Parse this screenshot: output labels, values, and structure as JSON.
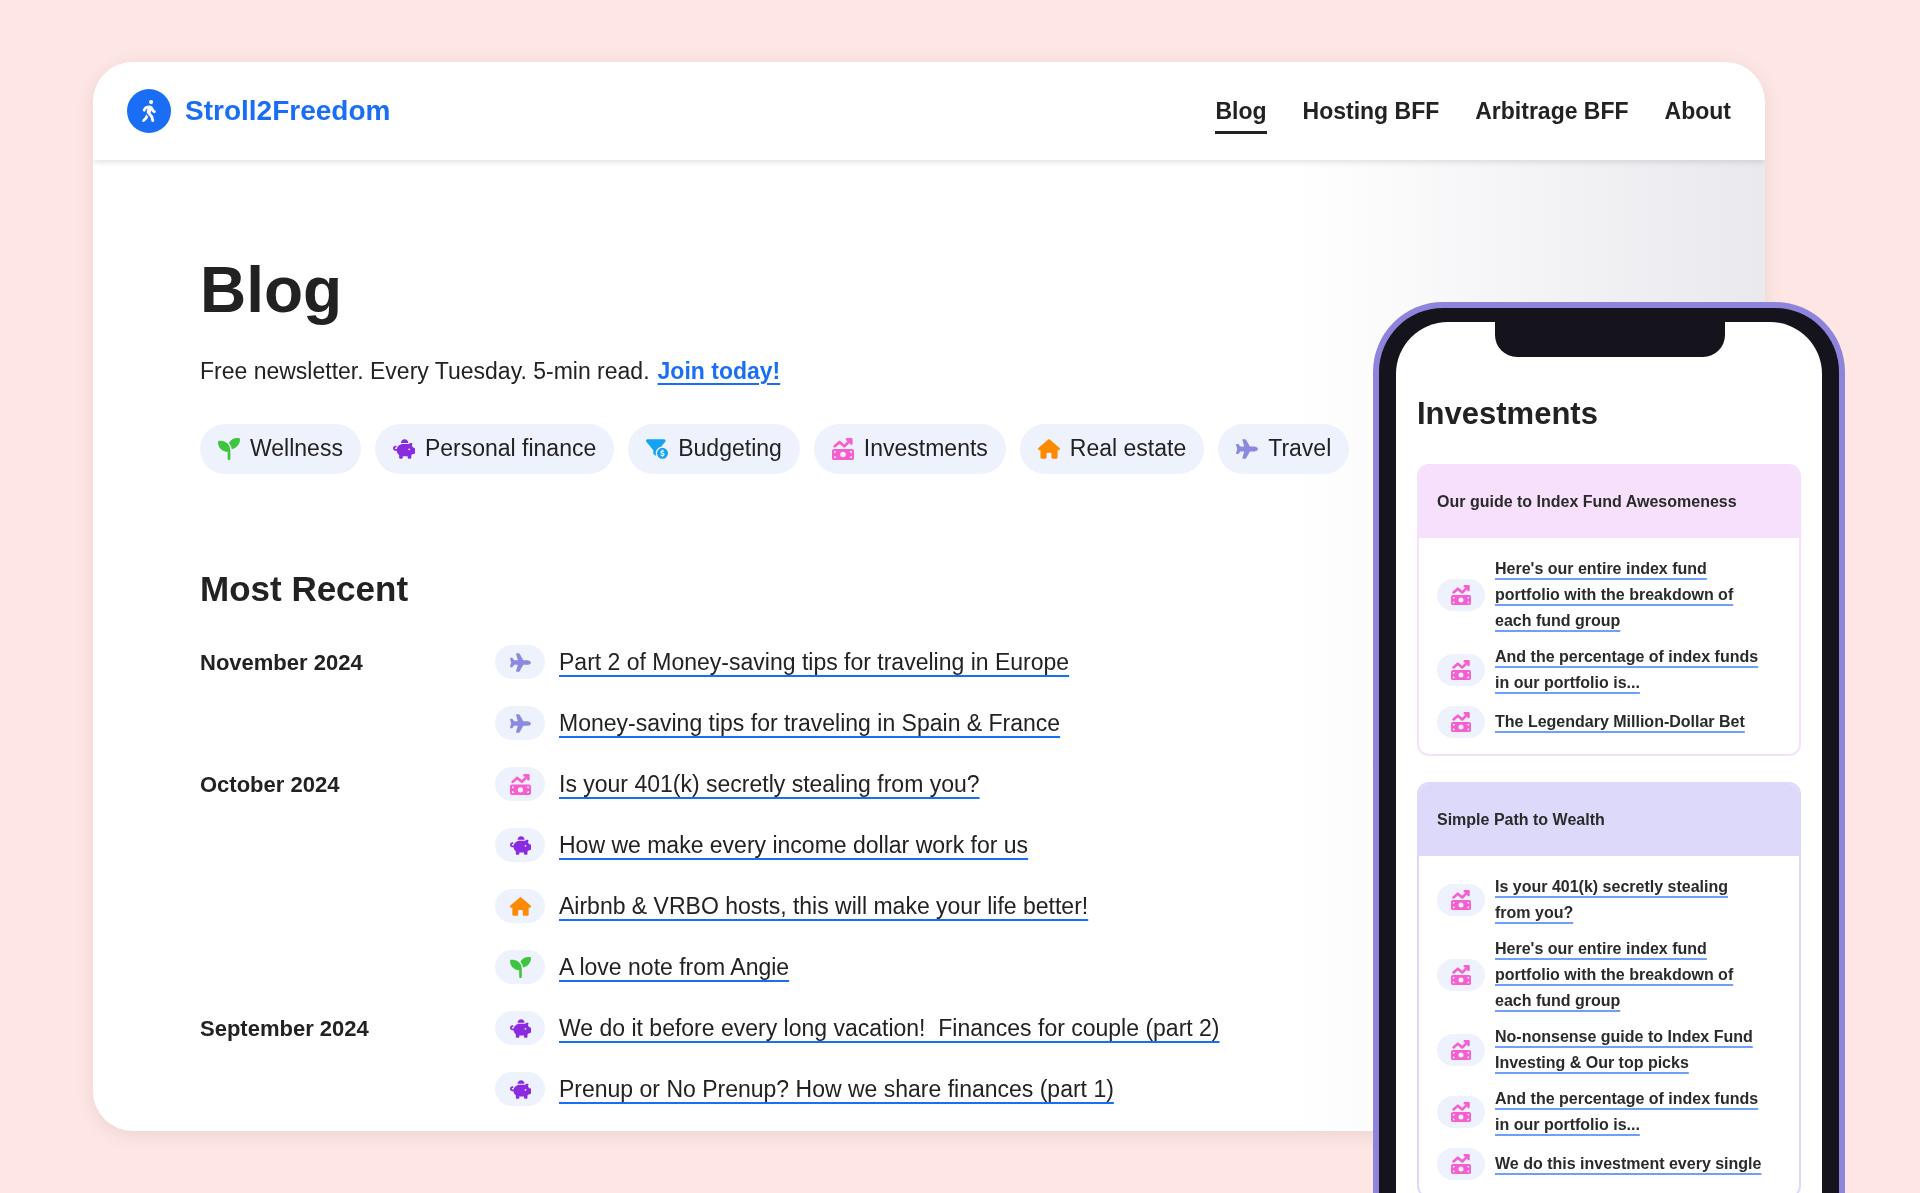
{
  "header": {
    "brand": "Stroll2Freedom",
    "nav": [
      {
        "label": "Blog",
        "selected": true
      },
      {
        "label": "Hosting BFF",
        "selected": false
      },
      {
        "label": "Arbitrage BFF",
        "selected": false
      },
      {
        "label": "About",
        "selected": false
      }
    ]
  },
  "page": {
    "title": "Blog",
    "newsletter": "Free newsletter. Every Tuesday. 5-min read.",
    "newsletter_link": "Join today!",
    "categories": [
      {
        "kind": "wellness",
        "label": "Wellness"
      },
      {
        "kind": "finance",
        "label": "Personal finance"
      },
      {
        "kind": "budgeting",
        "label": "Budgeting"
      },
      {
        "kind": "investments",
        "label": "Investments"
      },
      {
        "kind": "realestate",
        "label": "Real estate"
      },
      {
        "kind": "travel",
        "label": "Travel"
      }
    ],
    "recent_title": "Most Recent",
    "recent": [
      {
        "date": "November 2024",
        "posts": [
          {
            "kind": "travel",
            "title": "Part 2 of Money-saving tips for traveling in Europe"
          },
          {
            "kind": "travel",
            "title": "Money-saving tips for traveling in Spain & France"
          }
        ]
      },
      {
        "date": "October 2024",
        "posts": [
          {
            "kind": "investments",
            "title": "Is your 401(k) secretly stealing from you?"
          },
          {
            "kind": "finance",
            "title": "How we make every income dollar work for us"
          },
          {
            "kind": "realestate",
            "title": "Airbnb & VRBO hosts, this will make your life better!"
          },
          {
            "kind": "wellness",
            "title": "A love note from Angie"
          }
        ]
      },
      {
        "date": "September 2024",
        "posts": [
          {
            "kind": "finance",
            "title": "We do it before every long vacation!  Finances for couple (part 2)"
          },
          {
            "kind": "finance",
            "title": "Prenup or No Prenup? How we share finances (part 1)"
          }
        ]
      }
    ]
  },
  "phone": {
    "title": "Investments",
    "sections": [
      {
        "title": "Our guide to Index Fund Awesomeness",
        "color": "#f6e0fc",
        "posts": [
          {
            "kind": "investments",
            "title": "Here's our entire index fund portfolio with the breakdown of each fund group"
          },
          {
            "kind": "investments",
            "title": "And the percentage of index funds in our portfolio is..."
          },
          {
            "kind": "investments",
            "title": "The Legendary Million-Dollar Bet"
          }
        ]
      },
      {
        "title": "Simple Path to Wealth",
        "color": "#ddd9fb",
        "posts": [
          {
            "kind": "investments",
            "title": "Is your 401(k) secretly stealing from you?"
          },
          {
            "kind": "investments",
            "title": "Here's our entire index fund portfolio with the breakdown of each fund group"
          },
          {
            "kind": "investments",
            "title": "No-nonsense guide to Index Fund Investing & Our top picks"
          },
          {
            "kind": "investments",
            "title": "And the percentage of index funds in our portfolio is..."
          },
          {
            "kind": "investments",
            "title": "We do this investment every single"
          }
        ]
      }
    ]
  }
}
